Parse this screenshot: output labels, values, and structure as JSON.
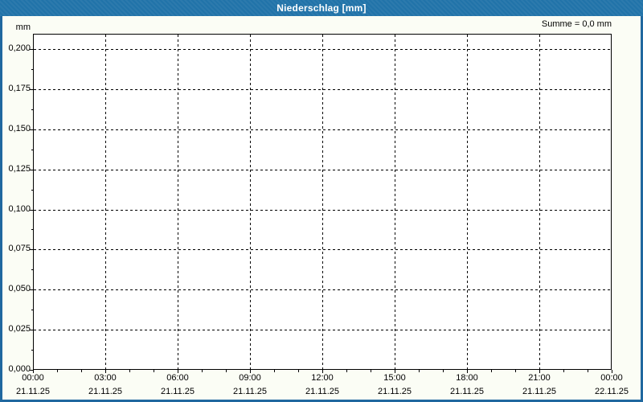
{
  "window": {
    "title": "Niederschlag [mm]",
    "colors": {
      "titlebar_blue": "#2173a9",
      "border_blue": "#20689f",
      "content_background": "#fbfdf5",
      "plot_background": "#ffffff",
      "grid_color": "#000000",
      "title_text": "#ffffff",
      "label_text": "#000000"
    }
  },
  "chart_data": {
    "type": "line",
    "title": "Niederschlag [mm]",
    "summary_label": "Summe = 0,0 mm",
    "unit": "mm",
    "ylabel": "mm",
    "xlabel": "",
    "ylim": [
      0,
      0.21
    ],
    "grid": "dashed",
    "legend": "none",
    "y_ticks": [
      {
        "value": 0.0,
        "label": "0,000"
      },
      {
        "value": 0.025,
        "label": "0,025"
      },
      {
        "value": 0.05,
        "label": "0,050"
      },
      {
        "value": 0.075,
        "label": "0,075"
      },
      {
        "value": 0.1,
        "label": "0,100"
      },
      {
        "value": 0.125,
        "label": "0,125"
      },
      {
        "value": 0.15,
        "label": "0,150"
      },
      {
        "value": 0.175,
        "label": "0,175"
      },
      {
        "value": 0.2,
        "label": "0,200"
      }
    ],
    "x_ticks": [
      {
        "time": "00:00",
        "date": "21.11.25"
      },
      {
        "time": "03:00",
        "date": "21.11.25"
      },
      {
        "time": "06:00",
        "date": "21.11.25"
      },
      {
        "time": "09:00",
        "date": "21.11.25"
      },
      {
        "time": "12:00",
        "date": "21.11.25"
      },
      {
        "time": "15:00",
        "date": "21.11.25"
      },
      {
        "time": "18:00",
        "date": "21.11.25"
      },
      {
        "time": "21:00",
        "date": "21.11.25"
      },
      {
        "time": "00:00",
        "date": "22.11.25"
      }
    ],
    "x_minor_ticks_per_major_interval": 3,
    "y_minor_ticks_per_major_interval": 2,
    "series": [
      {
        "name": "Niederschlag",
        "sum": "0,0 mm",
        "values": []
      }
    ]
  }
}
